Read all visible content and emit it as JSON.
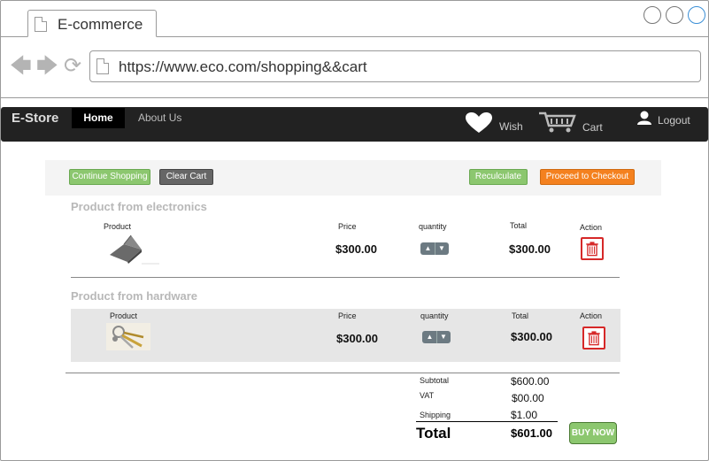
{
  "browser": {
    "tab_title": "E-commerce",
    "url": "https://www.eco.com/shopping&&cart"
  },
  "nav": {
    "brand": "E-Store",
    "home": "Home",
    "about": "About Us",
    "wish": "Wish",
    "cart": "Cart",
    "logout": "Logout"
  },
  "toolbar": {
    "continue_label": "Continue Shopping",
    "clear_label": "Clear Cart",
    "recalc_label": "Reculculate",
    "checkout_label": "Proceed to Checkout"
  },
  "columns": {
    "product": "Product",
    "price": "Price",
    "quantity": "quantity",
    "total": "Total",
    "action": "Action"
  },
  "sections": [
    {
      "title": "Product from electronics",
      "item": {
        "price": "$300.00",
        "total": "$300.00",
        "icon": "laptop"
      }
    },
    {
      "title": "Product from hardware",
      "item": {
        "price": "$300.00",
        "total": "$300.00",
        "icon": "keys"
      }
    }
  ],
  "summary": {
    "subtotal_label": "Subtotal",
    "subtotal_val": "$600.00",
    "vat_label": "VAT",
    "vat_val": "$00.00",
    "shipping_label": "Shipping",
    "shipping_val": "$1.00",
    "total_label": "Total",
    "total_val": "$601.00",
    "buy_label": "BUY NOW"
  },
  "colors": {
    "green": "#8cc76f",
    "orange": "#f4811f",
    "danger": "#d62828",
    "navbar": "#222222"
  }
}
